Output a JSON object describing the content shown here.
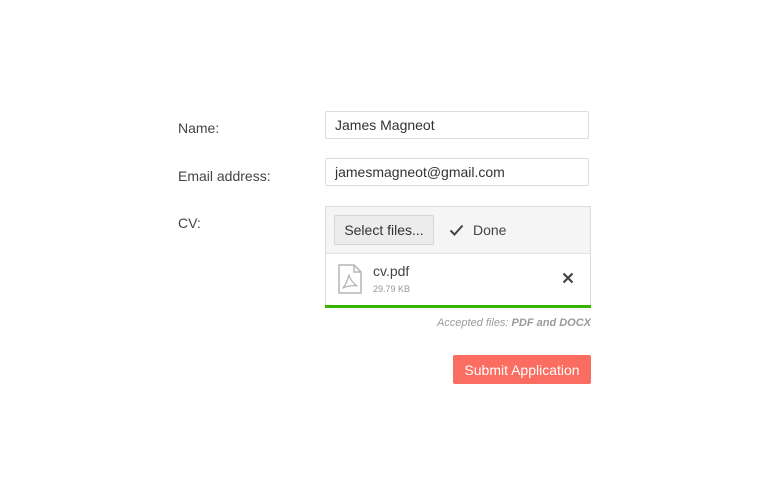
{
  "form": {
    "name_label": "Name:",
    "name_value": "James Magneot",
    "email_label": "Email address:",
    "email_value": "jamesmagneot@gmail.com",
    "cv_label": "CV:"
  },
  "upload": {
    "select_label": "Select files...",
    "status_label": "Done",
    "status_icon": "check-icon",
    "file": {
      "name": "cv.pdf",
      "size": "29.79 KB",
      "icon": "pdf-file-icon",
      "remove_icon": "close-icon"
    },
    "progress_percent": 100,
    "progress_color": "#37b400"
  },
  "hint": {
    "prefix": "Accepted files: ",
    "types": "PDF and DOCX"
  },
  "submit": {
    "label": "Submit Application",
    "color": "#fa6d60"
  }
}
